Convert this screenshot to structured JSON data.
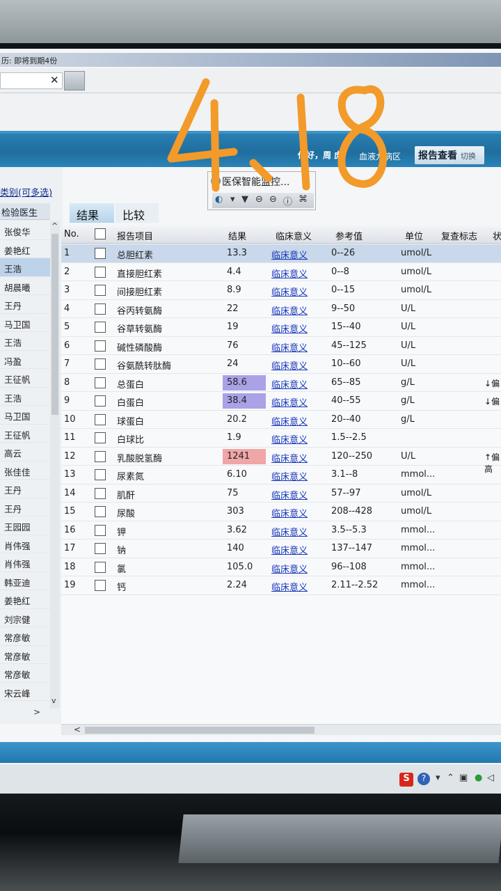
{
  "topbar": {
    "title": "历: 即将到期4份"
  },
  "header": {
    "greeting": "你好，周 虎",
    "ward": "血液九病区",
    "report_button": "报告查看",
    "switch_label": "切换"
  },
  "overlay_handwriting": "4、18",
  "left_panel": {
    "category_label": "类别(可多选)",
    "column_header": "检验医生",
    "doctors": [
      "张俊华",
      "姜艳红",
      "王浩",
      "胡晨曦",
      "王丹",
      "马卫国",
      "王浩",
      "冯盈",
      "王征帆",
      "王浩",
      "马卫国",
      "王征帆",
      "高云",
      "张佳佳",
      "王丹",
      "王丹",
      "王园园",
      "肖伟强",
      "肖伟强",
      "韩亚迪",
      "姜艳红",
      "刘宗健",
      "常彦敏",
      "常彦敏",
      "常彦敏",
      "宋云峰"
    ],
    "selected_index": 2
  },
  "tabs": [
    {
      "label": "结果"
    },
    {
      "label": "比较"
    }
  ],
  "float_panel": {
    "title": "医保智能监控..."
  },
  "table": {
    "headers": {
      "no": "No.",
      "item": "报告项目",
      "result": "结果",
      "meaning": "临床意义",
      "ref": "参考值",
      "unit": "单位",
      "recheck": "复查标志",
      "status": "状"
    },
    "rows": [
      {
        "no": "1",
        "item": "总胆红素",
        "result": "13.3",
        "meaning": "临床意义",
        "ref": "0--26",
        "unit": "umol/L",
        "flag": ""
      },
      {
        "no": "2",
        "item": "直接胆红素",
        "result": "4.4",
        "meaning": "临床意义",
        "ref": "0--8",
        "unit": "umol/L",
        "flag": ""
      },
      {
        "no": "3",
        "item": "间接胆红素",
        "result": "8.9",
        "meaning": "临床意义",
        "ref": "0--15",
        "unit": "umol/L",
        "flag": ""
      },
      {
        "no": "4",
        "item": "谷丙转氨酶",
        "result": "22",
        "meaning": "临床意义",
        "ref": "9--50",
        "unit": "U/L",
        "flag": ""
      },
      {
        "no": "5",
        "item": "谷草转氨酶",
        "result": "19",
        "meaning": "临床意义",
        "ref": "15--40",
        "unit": "U/L",
        "flag": ""
      },
      {
        "no": "6",
        "item": "碱性磷酸酶",
        "result": "76",
        "meaning": "临床意义",
        "ref": "45--125",
        "unit": "U/L",
        "flag": ""
      },
      {
        "no": "7",
        "item": "谷氨酰转肽酶",
        "result": "24",
        "meaning": "临床意义",
        "ref": "10--60",
        "unit": "U/L",
        "flag": ""
      },
      {
        "no": "8",
        "item": "总蛋白",
        "result": "58.6",
        "meaning": "临床意义",
        "ref": "65--85",
        "unit": "g/L",
        "flag": "↓偏"
      },
      {
        "no": "9",
        "item": "白蛋白",
        "result": "38.4",
        "meaning": "临床意义",
        "ref": "40--55",
        "unit": "g/L",
        "flag": "↓偏"
      },
      {
        "no": "10",
        "item": "球蛋白",
        "result": "20.2",
        "meaning": "临床意义",
        "ref": "20--40",
        "unit": "g/L",
        "flag": ""
      },
      {
        "no": "11",
        "item": "白球比",
        "result": "1.9",
        "meaning": "临床意义",
        "ref": "1.5--2.5",
        "unit": "",
        "flag": ""
      },
      {
        "no": "12",
        "item": "乳酸脱氢酶",
        "result": "1241",
        "meaning": "临床意义",
        "ref": "120--250",
        "unit": "U/L",
        "flag": "↑偏高"
      },
      {
        "no": "13",
        "item": "尿素氮",
        "result": "6.10",
        "meaning": "临床意义",
        "ref": "3.1--8",
        "unit": "mmol...",
        "flag": ""
      },
      {
        "no": "14",
        "item": "肌酐",
        "result": "75",
        "meaning": "临床意义",
        "ref": "57--97",
        "unit": "umol/L",
        "flag": ""
      },
      {
        "no": "15",
        "item": "尿酸",
        "result": "303",
        "meaning": "临床意义",
        "ref": "208--428",
        "unit": "umol/L",
        "flag": ""
      },
      {
        "no": "16",
        "item": "钾",
        "result": "3.62",
        "meaning": "临床意义",
        "ref": "3.5--5.3",
        "unit": "mmol...",
        "flag": ""
      },
      {
        "no": "17",
        "item": "钠",
        "result": "140",
        "meaning": "临床意义",
        "ref": "137--147",
        "unit": "mmol...",
        "flag": ""
      },
      {
        "no": "18",
        "item": "氯",
        "result": "105.0",
        "meaning": "临床意义",
        "ref": "96--108",
        "unit": "mmol...",
        "flag": ""
      },
      {
        "no": "19",
        "item": "钙",
        "result": "2.24",
        "meaning": "临床意义",
        "ref": "2.11--2.52",
        "unit": "mmol...",
        "flag": ""
      }
    ],
    "selected_row": 0
  },
  "colors": {
    "header_blue": "#2278ae",
    "low_highlight": "#a9a2e6",
    "high_highlight": "#f0a6a6",
    "link": "#1536b8"
  },
  "icons": [
    "close-icon",
    "ie-logo-icon",
    "dropdown-icon",
    "help-icon",
    "sogou-input-icon"
  ]
}
